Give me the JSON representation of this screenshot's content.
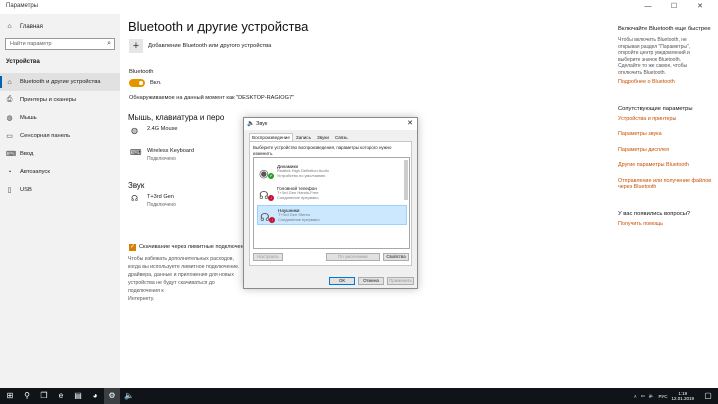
{
  "window": {
    "title": "Параметры",
    "minimize_icon": "—",
    "maximize_icon": "☐",
    "close_icon": "✕"
  },
  "sidebar": {
    "home": "Главная",
    "search_placeholder": "Найти параметр",
    "section": "Устройства",
    "items": [
      {
        "label": "Bluetooth и другие устройства",
        "icon": "bluetooth-icon",
        "glyph": "⌂",
        "active": true
      },
      {
        "label": "Принтеры и сканеры",
        "icon": "printer-icon",
        "glyph": "⎙"
      },
      {
        "label": "Мышь",
        "icon": "mouse-icon",
        "glyph": "◍"
      },
      {
        "label": "Сенсорная панель",
        "icon": "touchpad-icon",
        "glyph": "▭"
      },
      {
        "label": "Ввод",
        "icon": "keyboard-icon",
        "glyph": "⌨"
      },
      {
        "label": "Автозапуск",
        "icon": "autoplay-icon",
        "glyph": "◔"
      },
      {
        "label": "USB",
        "icon": "usb-icon",
        "glyph": "▯"
      }
    ]
  },
  "main": {
    "title": "Bluetooth и другие устройства",
    "add_label": "Добавление Bluetooth или другого устройства",
    "bluetooth_label": "Bluetooth",
    "toggle_label": "Вкл.",
    "discover_text": "Обнаруживаемое на данный момент как \"DESKTOP-RAGIOG7\"",
    "mouse_section": "Мышь, клавиатура и перо",
    "devices": [
      {
        "name": "2.4G Mouse",
        "status": ""
      },
      {
        "name": "Wireless Keyboard",
        "status": "Подключено"
      }
    ],
    "sound_section": "Звук",
    "sound_devices": [
      {
        "name": "T+3rd  Gen",
        "status": "Подключено"
      }
    ],
    "metered_label": "Скачивание через лимитные подключения",
    "metered_desc": "Чтобы избежать дополнительных расходов,\nкогда вы используете лимитное подключение.\nдрайвера, данные и приложения для новых\nустройства не будут скачиваться до подключения к\nИнтернету."
  },
  "right_panel": {
    "bt_title": "Включайте Bluetooth еще быстрее",
    "bt_text": "Чтобы включить Bluetooth, не\nоткрывая раздел \"Параметры\",\nоткройте центр уведомлений и\nвыберите значок Bluetooth.\nСделайте то же самое, чтобы\nотключить Bluetooth.",
    "bt_link": "Подробнее о Bluetooth",
    "related_title": "Сопутствующие параметры",
    "related_links": [
      "Устройства и принтеры",
      "Параметры звука",
      "Параметры дисплея",
      "Другие параметры Bluetooth",
      "Отправление или получение файлов через Bluetooth"
    ],
    "help_title": "У вас появились вопросы?",
    "help_link": "Получить помощь"
  },
  "sound_dialog": {
    "title": "Звук",
    "tabs": [
      "Воспроизведение",
      "Запись",
      "Звуки",
      "Связь"
    ],
    "instruction": "Выберите устройство воспроизведения, параметры которого нужно изменить.",
    "devices": [
      {
        "name": "Динамики",
        "sub1": "Realtek High Definition Audio",
        "sub2": "Устройство по умолчанию",
        "badge": "✔",
        "badge_color": "#1e9e1e",
        "icon": "speakers-icon"
      },
      {
        "name": "Головной телефон",
        "sub1": "T+3rd  Gen Hands-Free",
        "sub2": "Соединение прервано",
        "badge": "↓",
        "badge_color": "#c8102e",
        "icon": "headset-icon"
      },
      {
        "name": "Наушники",
        "sub1": "T+3rd  Gen Stereo",
        "sub2": "Соединение прервано",
        "badge": "↓",
        "badge_color": "#c8102e",
        "icon": "headphones-icon",
        "selected": true
      }
    ],
    "configure": "Настроить",
    "default_dropdown": "По умолчанию",
    "properties": "Свойства",
    "ok": "ОК",
    "cancel": "Отмена",
    "apply": "Применить"
  },
  "taskbar": {
    "lang": "РУС",
    "time": "1:19",
    "date": "12.01.2019"
  }
}
